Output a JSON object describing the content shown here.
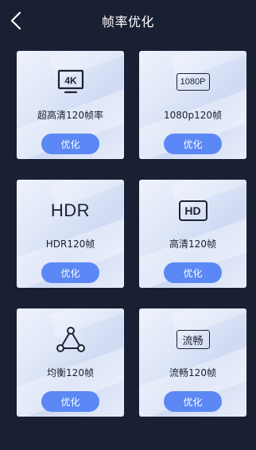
{
  "header": {
    "title": "帧率优化",
    "back_icon": "chevron-left-icon"
  },
  "cards": [
    {
      "label": "超高清120帧率",
      "button": "优化",
      "icon": "4k-icon",
      "icon_text": "4K"
    },
    {
      "label": "1080p120帧",
      "button": "优化",
      "icon": "1080p-icon",
      "icon_text": "1080P"
    },
    {
      "label": "HDR120帧",
      "button": "优化",
      "icon": "hdr-icon",
      "icon_text": "HDR"
    },
    {
      "label": "高清120帧",
      "button": "优化",
      "icon": "hd-icon",
      "icon_text": "HD"
    },
    {
      "label": "均衡120帧",
      "button": "优化",
      "icon": "balance-triangle-icon",
      "icon_text": ""
    },
    {
      "label": "流畅120帧",
      "button": "优化",
      "icon": "smooth-icon",
      "icon_text": "流畅"
    }
  ],
  "colors": {
    "background": "#1a2034",
    "button": "#5b88f5",
    "card_top": "#eef2fc"
  }
}
